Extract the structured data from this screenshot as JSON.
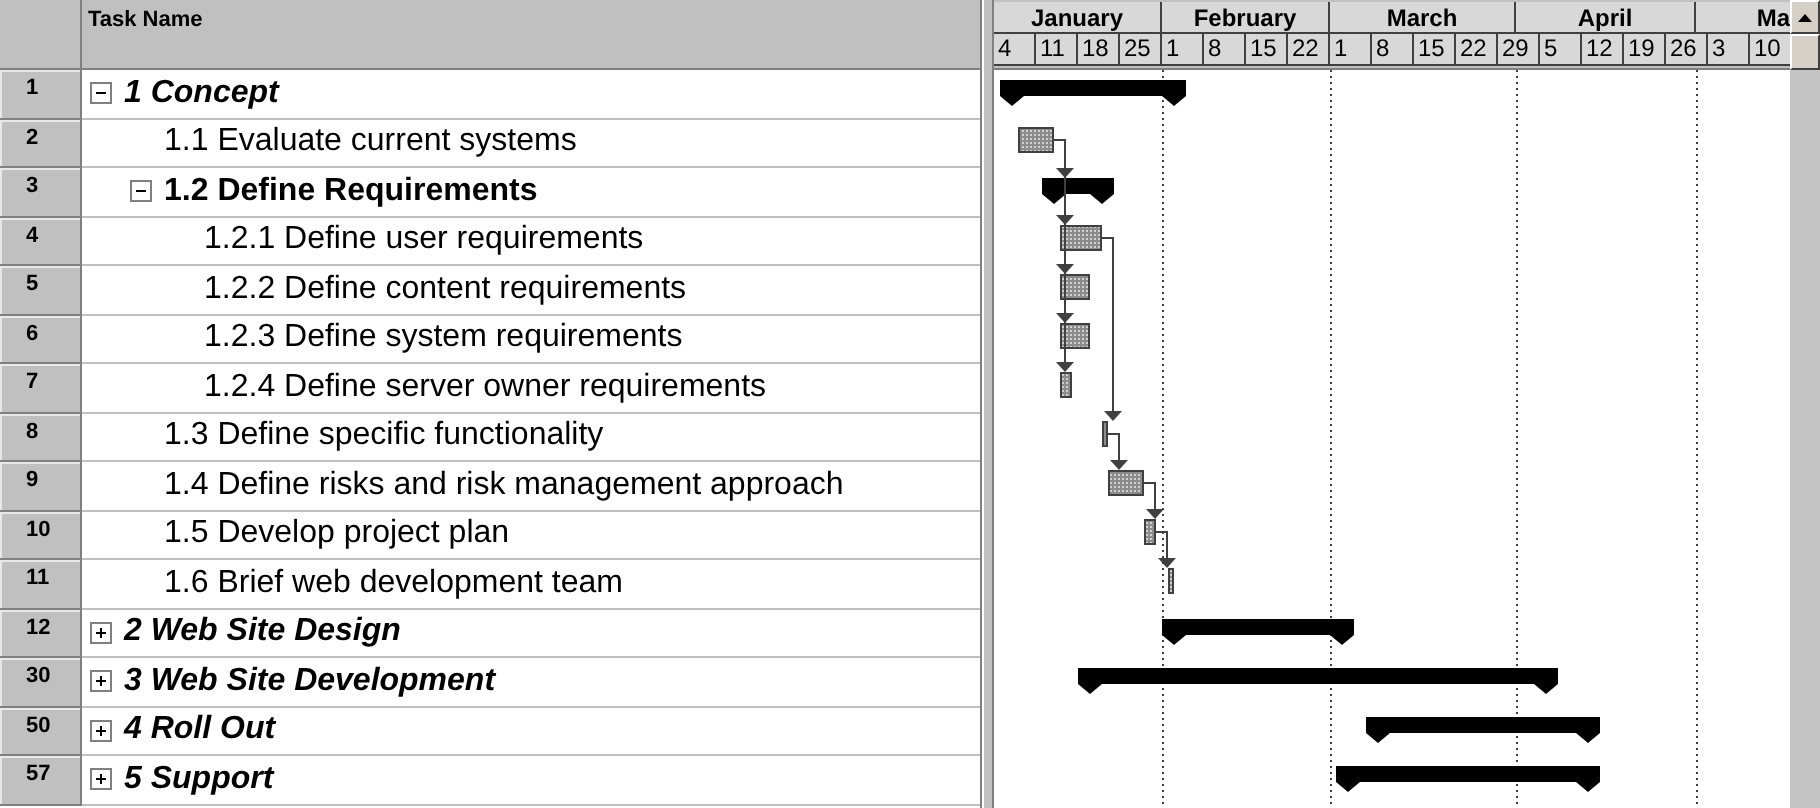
{
  "table": {
    "columns": [
      "Task Name"
    ]
  },
  "tasks": [
    {
      "id": "1",
      "name": "1 Concept",
      "kind": "summary",
      "expanded": true,
      "children": [
        {
          "id": "2",
          "name": "1.1 Evaluate current systems",
          "kind": "task"
        },
        {
          "id": "3",
          "name": "1.2 Define Requirements",
          "kind": "summary",
          "expanded": true,
          "children": [
            {
              "id": "4",
              "name": "1.2.1 Define user requirements",
              "kind": "task"
            },
            {
              "id": "5",
              "name": "1.2.2 Define content requirements",
              "kind": "task"
            },
            {
              "id": "6",
              "name": "1.2.3 Define system requirements",
              "kind": "task"
            },
            {
              "id": "7",
              "name": "1.2.4 Define server owner requirements",
              "kind": "task"
            }
          ]
        },
        {
          "id": "8",
          "name": "1.3 Define specific functionality",
          "kind": "task"
        },
        {
          "id": "9",
          "name": "1.4 Define risks and risk management approach",
          "kind": "task"
        },
        {
          "id": "10",
          "name": "1.5 Develop project plan",
          "kind": "task"
        },
        {
          "id": "11",
          "name": "1.6 Brief web development team",
          "kind": "task"
        }
      ]
    },
    {
      "id": "12",
      "name": "2 Web Site Design",
      "kind": "summary",
      "expanded": false
    },
    {
      "id": "30",
      "name": "3 Web Site Development",
      "kind": "summary",
      "expanded": false
    },
    {
      "id": "50",
      "name": "4 Roll Out",
      "kind": "summary",
      "expanded": false
    },
    {
      "id": "57",
      "name": "5 Support",
      "kind": "summary",
      "expanded": false
    }
  ],
  "timescale": {
    "months": [
      "January",
      "February",
      "March",
      "April",
      "Ma"
    ],
    "weeks": [
      "4",
      "11",
      "18",
      "25",
      "1",
      "8",
      "15",
      "22",
      "1",
      "8",
      "15",
      "22",
      "29",
      "5",
      "12",
      "19",
      "26",
      "3",
      "10"
    ]
  }
}
